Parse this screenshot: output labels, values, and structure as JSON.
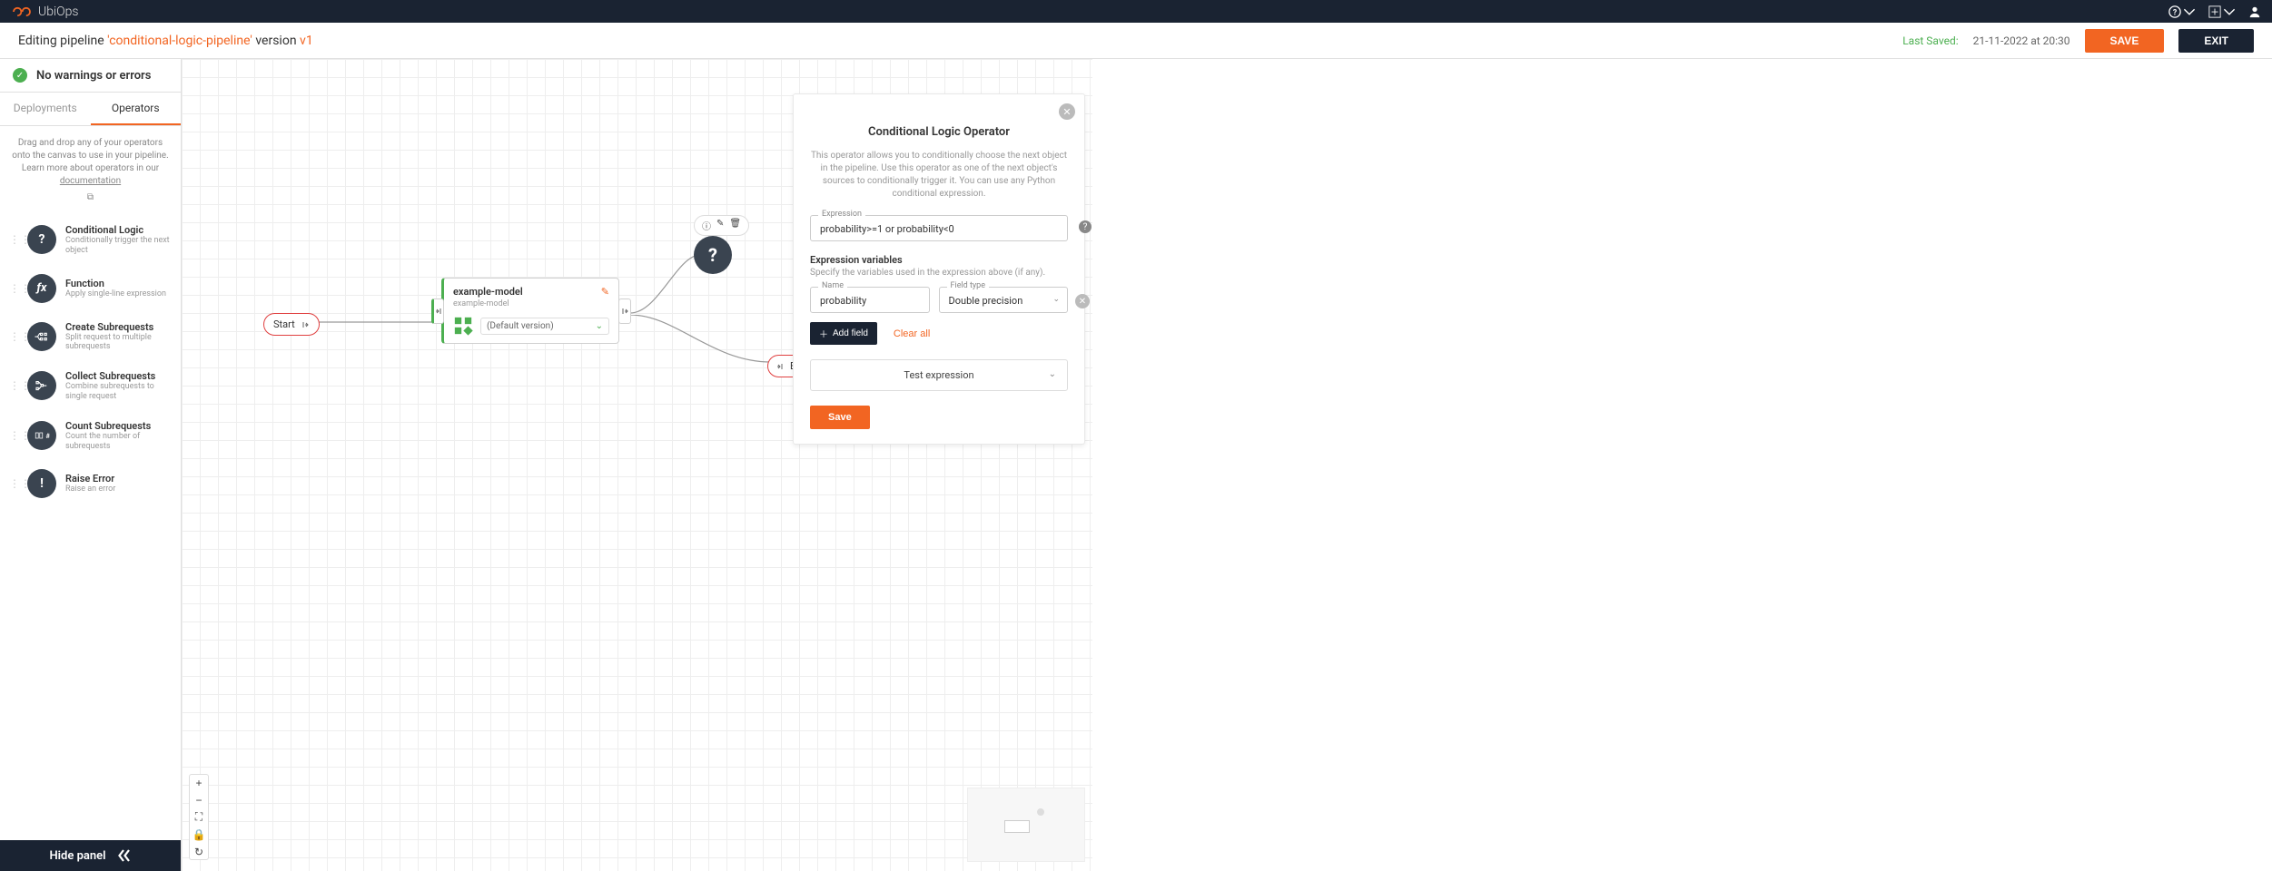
{
  "topnav": {
    "brand": "UbiOps"
  },
  "header": {
    "editing_prefix": "Editing pipeline ",
    "pipeline_name": "'conditional-logic-pipeline'",
    "version_prefix": " version ",
    "version": "v1",
    "last_saved_label": "Last Saved:",
    "last_saved_time": "21-11-2022 at 20:30",
    "save_label": "SAVE",
    "exit_label": "EXIT"
  },
  "sidebar": {
    "status_text": "No warnings or errors",
    "tabs": {
      "deployments": "Deployments",
      "operators": "Operators"
    },
    "hint_pre": "Drag and drop any of your operators onto the canvas to use in your pipeline. Learn more about operators in our ",
    "hint_link": "documentation",
    "operators": [
      {
        "title": "Conditional Logic",
        "desc": "Conditionally trigger the next object",
        "icon": "question"
      },
      {
        "title": "Function",
        "desc": "Apply single-line expression",
        "icon": "fx"
      },
      {
        "title": "Create Subrequests",
        "desc": "Split request to multiple subrequests",
        "icon": "split"
      },
      {
        "title": "Collect Subrequests",
        "desc": "Combine subrequests to single request",
        "icon": "collect"
      },
      {
        "title": "Count Subrequests",
        "desc": "Count the number of subrequests",
        "icon": "count"
      },
      {
        "title": "Raise Error",
        "desc": "Raise an error",
        "icon": "exclaim"
      }
    ],
    "hide_panel": "Hide panel"
  },
  "canvas": {
    "start_label": "Start",
    "end_label": "En",
    "model": {
      "title": "example-model",
      "subtitle": "example-model",
      "version_select": "(Default version)"
    }
  },
  "panel": {
    "title": "Conditional Logic Operator",
    "description": "This operator allows you to conditionally choose the next object in the pipeline. Use this operator as one of the next object's sources to conditionally trigger it. You can use any Python conditional expression.",
    "expression_label": "Expression",
    "expression_value": "probability>=1 or probability<0",
    "vars_title": "Expression variables",
    "vars_desc": "Specify the variables used in the expression above (if any).",
    "var_name_label": "Name",
    "var_name_value": "probability",
    "var_type_label": "Field type",
    "var_type_value": "Double precision",
    "add_field": "Add field",
    "clear_all": "Clear all",
    "test_expression": "Test expression",
    "save": "Save"
  }
}
